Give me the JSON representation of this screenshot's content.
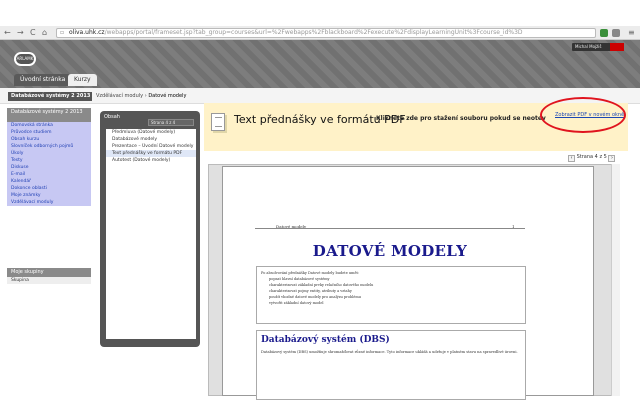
{
  "browser": {
    "nav": {
      "back": "←",
      "forward": "→",
      "reload": "C",
      "home": "⌂"
    },
    "url_domain": "oliva.uhk.cz",
    "url_rest": "/webapps/portal/frameset.jsp?tab_group=courses&url=%2Fwebapps%2Fblackboard%2Fexecute%2FdisplayLearningUnit%3Fcourse_id%3D",
    "menu_icon": "≡"
  },
  "header": {
    "logo_text": "ARLAMK",
    "user": "Michal Mojžiš",
    "tabs": [
      "Úvodní stránka",
      "Kurzy"
    ]
  },
  "breadcrumb": {
    "course": "Databázové systémy 2 2013",
    "items": [
      "Vzdělávací moduly",
      "Datové modely"
    ],
    "sep": "›"
  },
  "sidebar": {
    "course_head": "Databázové systémy 2 2013",
    "items": [
      "Domovská stránka",
      "Průvodce studiem",
      "Obsah kurzu",
      "Slovníček odborných pojmů",
      "Úkoly",
      "Testy",
      "Diskuse",
      "E-mail",
      "Kalendář",
      "Dokonce oblasti",
      "Moje známky",
      "Vzdělávací moduly"
    ],
    "groups_head": "Moje skupiny",
    "groups_item": "Skupina"
  },
  "files": {
    "head": "Obsah",
    "select": "Strana 4 z 4",
    "items": [
      "Předmluva (Datové modely)",
      "Databázové modely",
      "Prezentace – Úvodní Datové modely",
      "Text přednášky ve formátu PDF",
      "Autotest (Datové modely)"
    ]
  },
  "banner": {
    "title": "Text přednášky ve formátu PDF",
    "subtitle": "Klikněte zde pro stažení souboru pokud se neotevře",
    "new_window": "Zobrazit PDF v novém okně"
  },
  "pager": {
    "prev": "‹",
    "next": "›",
    "label": "Strana 4 z 5"
  },
  "pdf": {
    "running_head": "Datové modely",
    "page_number": "1",
    "title": "DATOVÉ MODELY",
    "lead": "Po absolvování přednášky Datové modely budete umět:",
    "bullets": [
      "popsat hlavní databázové systémy",
      "charakterizovat základní prvky relačního datového modelu",
      "charakterizovat pojmy entity, atributy a vztahy",
      "použít vhodné datové modely pro analýzu problému",
      "vytvořit základní datový model"
    ],
    "section_title": "Databázový systém (DBS)",
    "section_text": "Databázový systém (DBS) umožňuje shromažďovat různé informace. Tyto informace ukládá a udržuje v platném stavu na spravedlivé úrovni."
  }
}
